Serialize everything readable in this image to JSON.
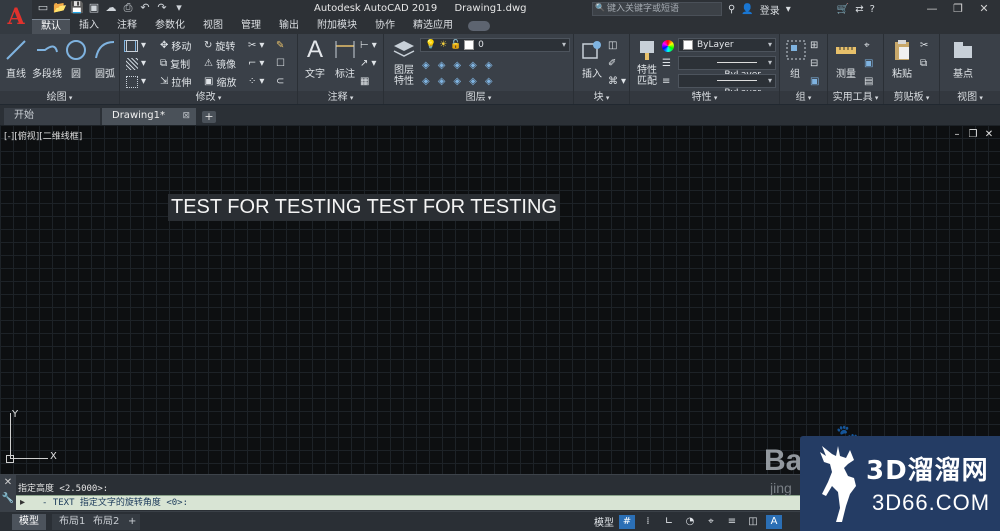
{
  "title_bar": {
    "app_logo": "A",
    "app_name": "Autodesk AutoCAD 2019",
    "file_name": "Drawing1.dwg",
    "search_placeholder": "键入关键字或短语",
    "login": "登录",
    "help": "?"
  },
  "ribbon_tabs": [
    "默认",
    "插入",
    "注释",
    "参数化",
    "视图",
    "管理",
    "输出",
    "附加模块",
    "协作",
    "精选应用"
  ],
  "ribbon": {
    "draw": {
      "label": "绘图",
      "line": "直线",
      "polyline": "多段线",
      "circle": "圆",
      "arc": "圆弧"
    },
    "modify": {
      "label": "修改",
      "move": "移动",
      "rotate": "旋转",
      "copy": "复制",
      "mirror": "镜像",
      "stretch": "拉伸",
      "scale": "缩放"
    },
    "annotation": {
      "label": "注释",
      "text": "文字",
      "dimension": "标注"
    },
    "layers": {
      "label": "图层",
      "layer_props": "图层\n特性",
      "current_layer": "0"
    },
    "block": {
      "label": "块",
      "insert": "插入"
    },
    "properties": {
      "label": "特性",
      "match": "特性\n匹配",
      "color": "ByLayer",
      "linetype": "ByLayer",
      "lineweight": "ByLayer"
    },
    "groups": {
      "label": "组",
      "group": "组"
    },
    "utilities": {
      "label": "实用工具",
      "measure": "测量"
    },
    "clipboard": {
      "label": "剪贴板",
      "paste": "粘贴"
    },
    "view": {
      "label": "视图",
      "base": "基点"
    }
  },
  "doc_tabs": {
    "start": "开始",
    "drawing": "Drawing1*"
  },
  "viewport": {
    "label": "[-][俯视][二维线框]",
    "text_object": "TEST FOR TESTING TEST FOR TESTING",
    "ucs_x": "X",
    "ucs_y": "Y"
  },
  "command": {
    "history": "指定高度 <2.5000>:",
    "prompt": "- TEXT 指定文字的旋转角度 <0>:"
  },
  "status": {
    "model_tab": "模型",
    "layout1": "布局1",
    "layout2": "布局2",
    "model_button": "模型"
  },
  "watermark": {
    "brand_cn": "3D溜溜网",
    "brand_url": "3D66.COM",
    "baidu": "Ba",
    "baidu_sub": "jing"
  },
  "colors": {
    "canvas": "#0d0f11",
    "ribbon": "#3a4048",
    "accent": "#2b6fb5",
    "watermark_bg": "#243c64"
  }
}
